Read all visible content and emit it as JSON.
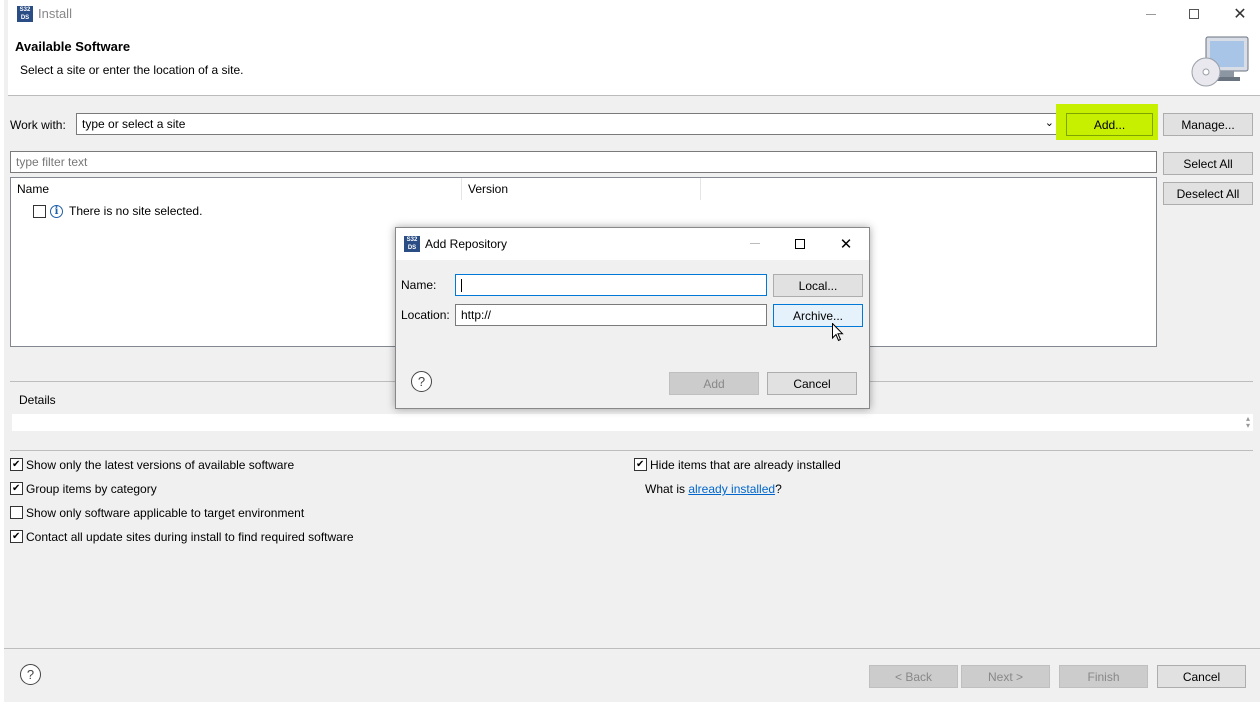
{
  "window": {
    "title": "Install",
    "app_icon_text": "S32 DS"
  },
  "header": {
    "title": "Available Software",
    "description": "Select a site or enter the location of a site."
  },
  "work_with": {
    "label": "Work with:",
    "combo_value": "type or select a site",
    "add_label": "Add...",
    "manage_label": "Manage..."
  },
  "filter": {
    "placeholder": "type filter text",
    "select_all_label": "Select All",
    "deselect_all_label": "Deselect All"
  },
  "table": {
    "columns": [
      "Name",
      "Version"
    ],
    "rows": [
      {
        "text": "There is no site selected.",
        "checked": false,
        "icon": "info-icon"
      }
    ]
  },
  "details": {
    "label": "Details"
  },
  "options": {
    "left": [
      {
        "label": "Show only the latest versions of available software",
        "checked": true
      },
      {
        "label": "Group items by category",
        "checked": true
      },
      {
        "label": "Show only software applicable to target environment",
        "checked": false
      },
      {
        "label": "Contact all update sites during install to find required software",
        "checked": true
      }
    ],
    "hide_installed": {
      "label": "Hide items that are already installed",
      "checked": true
    },
    "what_is_prefix": "What is ",
    "what_is_link": "already installed",
    "what_is_suffix": "?"
  },
  "footer": {
    "back_label": "< Back",
    "next_label": "Next >",
    "finish_label": "Finish",
    "cancel_label": "Cancel"
  },
  "dialog": {
    "title": "Add Repository",
    "name_label": "Name:",
    "name_value": "",
    "location_label": "Location:",
    "location_value": "http://",
    "local_label": "Local...",
    "archive_label": "Archive...",
    "add_label": "Add",
    "cancel_label": "Cancel"
  },
  "colors": {
    "highlight": "#c6f000",
    "link": "#0066cc",
    "focus": "#0078d7"
  }
}
